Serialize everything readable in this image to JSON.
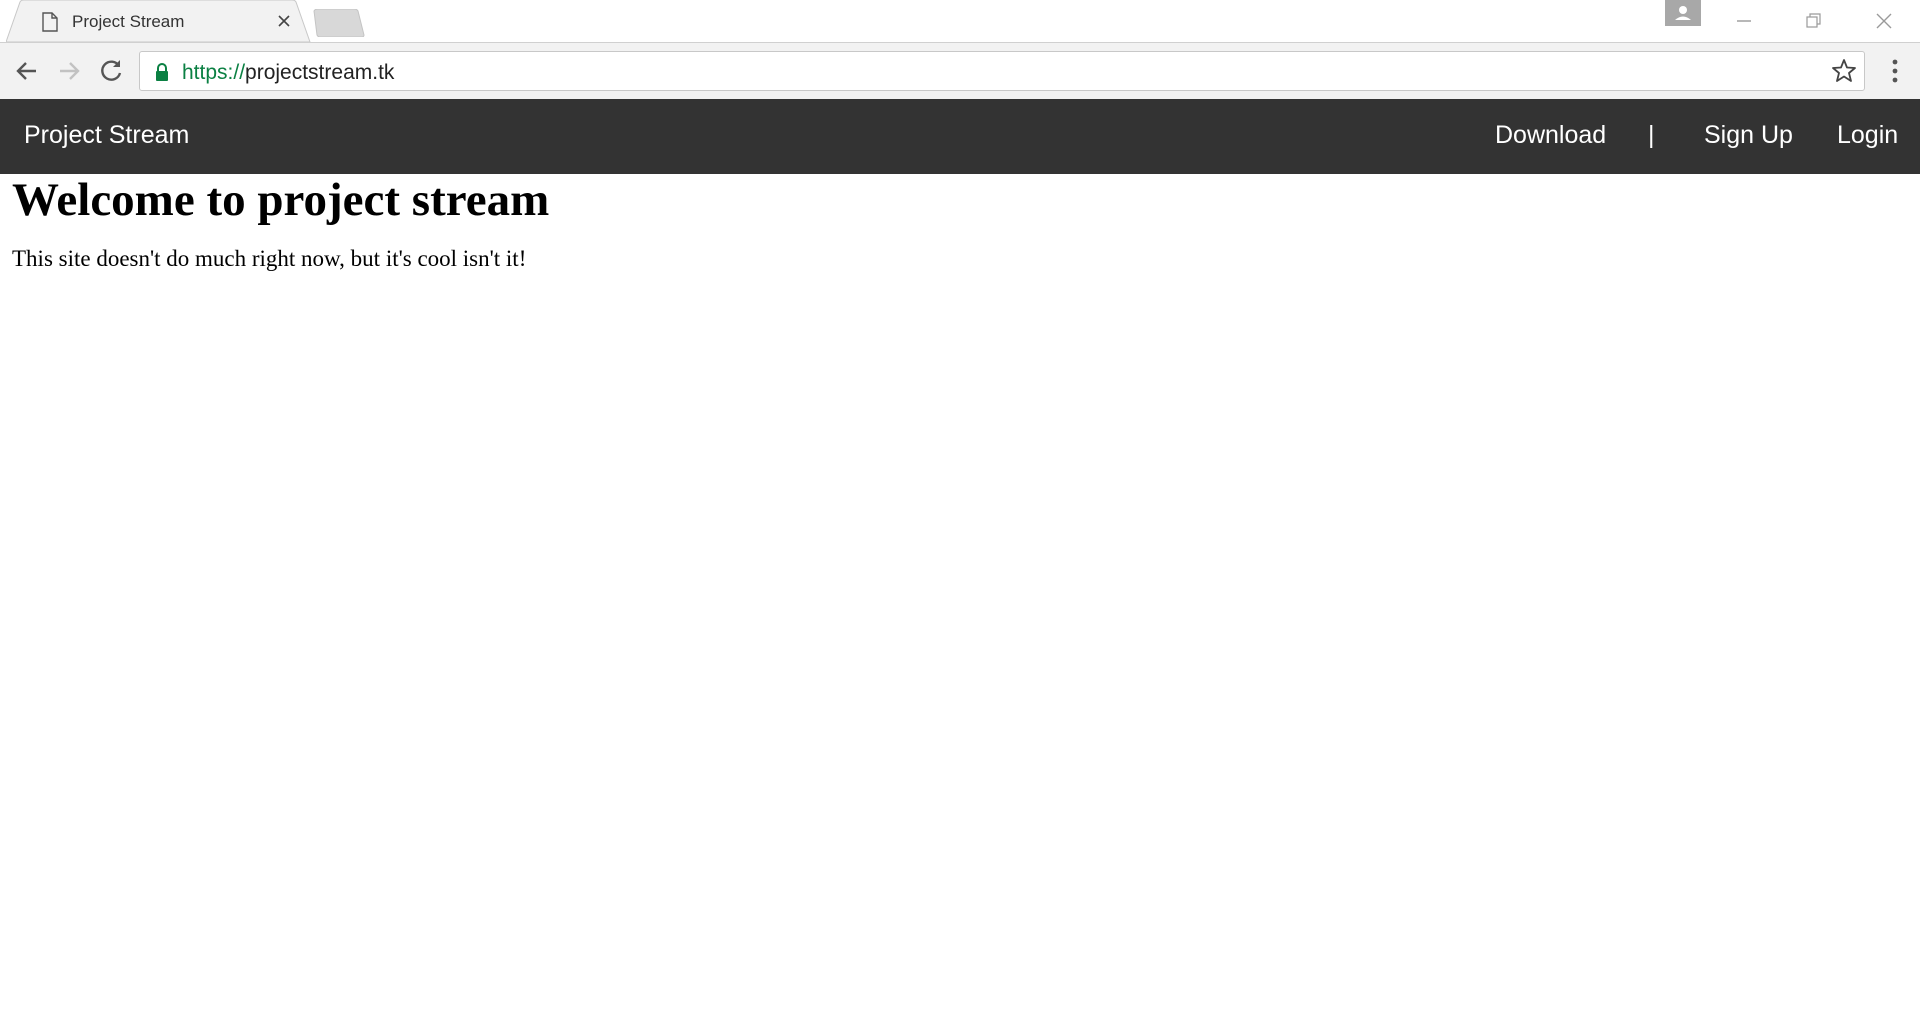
{
  "browser": {
    "tab_title": "Project Stream",
    "url_scheme": "https://",
    "url_host": "projectstream.tk",
    "colors": {
      "secure": "#0b8043",
      "tab_text": "#333333",
      "chrome_bg": "#f2f2f2"
    }
  },
  "site": {
    "brand": "Project Stream",
    "nav": {
      "download": "Download",
      "separator": "|",
      "signup": "Sign Up",
      "login": "Login"
    },
    "colors": {
      "navbar_bg": "#333333",
      "navbar_text": "#ffffff"
    }
  },
  "main": {
    "heading": "Welcome to project stream",
    "body": "This site doesn't do much right now, but it's cool isn't it!"
  },
  "icons": [
    "page-icon",
    "close-icon",
    "new-tab-icon",
    "profile-icon",
    "minimize-icon",
    "restore-icon",
    "close-window-icon",
    "back-arrow-icon",
    "forward-arrow-icon",
    "reload-icon",
    "lock-icon",
    "star-icon",
    "kebab-menu-icon"
  ]
}
